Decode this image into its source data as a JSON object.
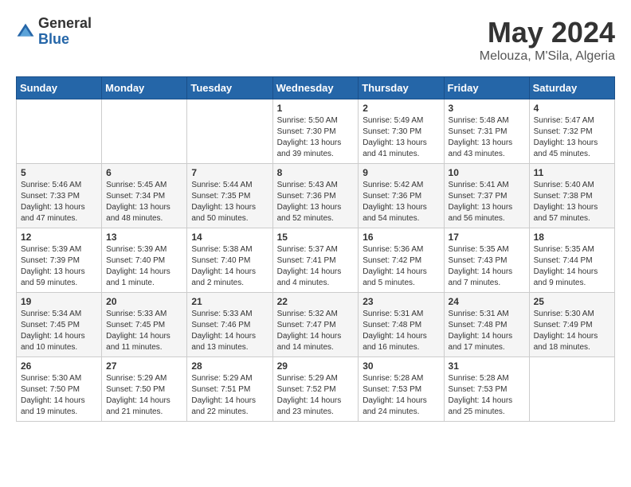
{
  "logo": {
    "general": "General",
    "blue": "Blue"
  },
  "title": {
    "month": "May 2024",
    "location": "Melouza, M'Sila, Algeria"
  },
  "weekdays": [
    "Sunday",
    "Monday",
    "Tuesday",
    "Wednesday",
    "Thursday",
    "Friday",
    "Saturday"
  ],
  "weeks": [
    [
      {
        "day": "",
        "sunrise": "",
        "sunset": "",
        "daylight": ""
      },
      {
        "day": "",
        "sunrise": "",
        "sunset": "",
        "daylight": ""
      },
      {
        "day": "",
        "sunrise": "",
        "sunset": "",
        "daylight": ""
      },
      {
        "day": "1",
        "sunrise": "Sunrise: 5:50 AM",
        "sunset": "Sunset: 7:30 PM",
        "daylight": "Daylight: 13 hours and 39 minutes."
      },
      {
        "day": "2",
        "sunrise": "Sunrise: 5:49 AM",
        "sunset": "Sunset: 7:30 PM",
        "daylight": "Daylight: 13 hours and 41 minutes."
      },
      {
        "day": "3",
        "sunrise": "Sunrise: 5:48 AM",
        "sunset": "Sunset: 7:31 PM",
        "daylight": "Daylight: 13 hours and 43 minutes."
      },
      {
        "day": "4",
        "sunrise": "Sunrise: 5:47 AM",
        "sunset": "Sunset: 7:32 PM",
        "daylight": "Daylight: 13 hours and 45 minutes."
      }
    ],
    [
      {
        "day": "5",
        "sunrise": "Sunrise: 5:46 AM",
        "sunset": "Sunset: 7:33 PM",
        "daylight": "Daylight: 13 hours and 47 minutes."
      },
      {
        "day": "6",
        "sunrise": "Sunrise: 5:45 AM",
        "sunset": "Sunset: 7:34 PM",
        "daylight": "Daylight: 13 hours and 48 minutes."
      },
      {
        "day": "7",
        "sunrise": "Sunrise: 5:44 AM",
        "sunset": "Sunset: 7:35 PM",
        "daylight": "Daylight: 13 hours and 50 minutes."
      },
      {
        "day": "8",
        "sunrise": "Sunrise: 5:43 AM",
        "sunset": "Sunset: 7:36 PM",
        "daylight": "Daylight: 13 hours and 52 minutes."
      },
      {
        "day": "9",
        "sunrise": "Sunrise: 5:42 AM",
        "sunset": "Sunset: 7:36 PM",
        "daylight": "Daylight: 13 hours and 54 minutes."
      },
      {
        "day": "10",
        "sunrise": "Sunrise: 5:41 AM",
        "sunset": "Sunset: 7:37 PM",
        "daylight": "Daylight: 13 hours and 56 minutes."
      },
      {
        "day": "11",
        "sunrise": "Sunrise: 5:40 AM",
        "sunset": "Sunset: 7:38 PM",
        "daylight": "Daylight: 13 hours and 57 minutes."
      }
    ],
    [
      {
        "day": "12",
        "sunrise": "Sunrise: 5:39 AM",
        "sunset": "Sunset: 7:39 PM",
        "daylight": "Daylight: 13 hours and 59 minutes."
      },
      {
        "day": "13",
        "sunrise": "Sunrise: 5:39 AM",
        "sunset": "Sunset: 7:40 PM",
        "daylight": "Daylight: 14 hours and 1 minute."
      },
      {
        "day": "14",
        "sunrise": "Sunrise: 5:38 AM",
        "sunset": "Sunset: 7:40 PM",
        "daylight": "Daylight: 14 hours and 2 minutes."
      },
      {
        "day": "15",
        "sunrise": "Sunrise: 5:37 AM",
        "sunset": "Sunset: 7:41 PM",
        "daylight": "Daylight: 14 hours and 4 minutes."
      },
      {
        "day": "16",
        "sunrise": "Sunrise: 5:36 AM",
        "sunset": "Sunset: 7:42 PM",
        "daylight": "Daylight: 14 hours and 5 minutes."
      },
      {
        "day": "17",
        "sunrise": "Sunrise: 5:35 AM",
        "sunset": "Sunset: 7:43 PM",
        "daylight": "Daylight: 14 hours and 7 minutes."
      },
      {
        "day": "18",
        "sunrise": "Sunrise: 5:35 AM",
        "sunset": "Sunset: 7:44 PM",
        "daylight": "Daylight: 14 hours and 9 minutes."
      }
    ],
    [
      {
        "day": "19",
        "sunrise": "Sunrise: 5:34 AM",
        "sunset": "Sunset: 7:45 PM",
        "daylight": "Daylight: 14 hours and 10 minutes."
      },
      {
        "day": "20",
        "sunrise": "Sunrise: 5:33 AM",
        "sunset": "Sunset: 7:45 PM",
        "daylight": "Daylight: 14 hours and 11 minutes."
      },
      {
        "day": "21",
        "sunrise": "Sunrise: 5:33 AM",
        "sunset": "Sunset: 7:46 PM",
        "daylight": "Daylight: 14 hours and 13 minutes."
      },
      {
        "day": "22",
        "sunrise": "Sunrise: 5:32 AM",
        "sunset": "Sunset: 7:47 PM",
        "daylight": "Daylight: 14 hours and 14 minutes."
      },
      {
        "day": "23",
        "sunrise": "Sunrise: 5:31 AM",
        "sunset": "Sunset: 7:48 PM",
        "daylight": "Daylight: 14 hours and 16 minutes."
      },
      {
        "day": "24",
        "sunrise": "Sunrise: 5:31 AM",
        "sunset": "Sunset: 7:48 PM",
        "daylight": "Daylight: 14 hours and 17 minutes."
      },
      {
        "day": "25",
        "sunrise": "Sunrise: 5:30 AM",
        "sunset": "Sunset: 7:49 PM",
        "daylight": "Daylight: 14 hours and 18 minutes."
      }
    ],
    [
      {
        "day": "26",
        "sunrise": "Sunrise: 5:30 AM",
        "sunset": "Sunset: 7:50 PM",
        "daylight": "Daylight: 14 hours and 19 minutes."
      },
      {
        "day": "27",
        "sunrise": "Sunrise: 5:29 AM",
        "sunset": "Sunset: 7:50 PM",
        "daylight": "Daylight: 14 hours and 21 minutes."
      },
      {
        "day": "28",
        "sunrise": "Sunrise: 5:29 AM",
        "sunset": "Sunset: 7:51 PM",
        "daylight": "Daylight: 14 hours and 22 minutes."
      },
      {
        "day": "29",
        "sunrise": "Sunrise: 5:29 AM",
        "sunset": "Sunset: 7:52 PM",
        "daylight": "Daylight: 14 hours and 23 minutes."
      },
      {
        "day": "30",
        "sunrise": "Sunrise: 5:28 AM",
        "sunset": "Sunset: 7:53 PM",
        "daylight": "Daylight: 14 hours and 24 minutes."
      },
      {
        "day": "31",
        "sunrise": "Sunrise: 5:28 AM",
        "sunset": "Sunset: 7:53 PM",
        "daylight": "Daylight: 14 hours and 25 minutes."
      },
      {
        "day": "",
        "sunrise": "",
        "sunset": "",
        "daylight": ""
      }
    ]
  ]
}
